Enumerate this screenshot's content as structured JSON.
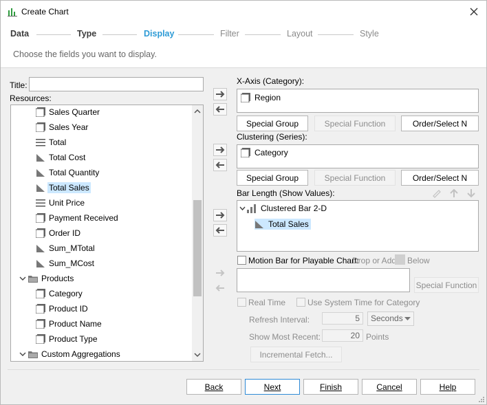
{
  "window": {
    "title": "Create Chart",
    "close_icon": "close-icon"
  },
  "steps": [
    {
      "label": "Data",
      "state": "done"
    },
    {
      "label": "Type",
      "state": "done"
    },
    {
      "label": "Display",
      "state": "active"
    },
    {
      "label": "Filter",
      "state": "todo"
    },
    {
      "label": "Layout",
      "state": "todo"
    },
    {
      "label": "Style",
      "state": "todo"
    }
  ],
  "subtitle": "Choose the fields you want to display.",
  "left": {
    "title_label": "Title:",
    "title_value": "",
    "resources_label": "Resources:",
    "tree": [
      {
        "label": "Sales Quarter",
        "icon": "dimension-icon"
      },
      {
        "label": "Sales Year",
        "icon": "dimension-icon"
      },
      {
        "label": "Total",
        "icon": "text-field-icon"
      },
      {
        "label": "Total Cost",
        "icon": "measure-icon"
      },
      {
        "label": "Total Quantity",
        "icon": "measure-icon"
      },
      {
        "label": "Total Sales",
        "icon": "measure-icon",
        "selected": true
      },
      {
        "label": "Unit Price",
        "icon": "text-field-icon"
      },
      {
        "label": "Payment Received",
        "icon": "dimension-icon"
      },
      {
        "label": "Order ID",
        "icon": "dimension-icon"
      },
      {
        "label": "Sum_MTotal",
        "icon": "measure-icon"
      },
      {
        "label": "Sum_MCost",
        "icon": "measure-icon"
      },
      {
        "label": "Products",
        "icon": "folder-icon",
        "folder": true
      },
      {
        "label": "Category",
        "icon": "dimension-icon"
      },
      {
        "label": "Product ID",
        "icon": "dimension-icon"
      },
      {
        "label": "Product Name",
        "icon": "dimension-icon"
      },
      {
        "label": "Product Type",
        "icon": "dimension-icon"
      },
      {
        "label": "Custom Aggregations",
        "icon": "folder-icon",
        "folder": true
      }
    ]
  },
  "xaxis": {
    "label": "X-Axis (Category):",
    "items": [
      "Region"
    ],
    "special_group": "Special Group",
    "special_function": "Special Function",
    "order_select": "Order/Select N"
  },
  "clustering": {
    "label": "Clustering (Series):",
    "items": [
      "Category"
    ],
    "special_group": "Special Group",
    "special_function": "Special Function",
    "order_select": "Order/Select N"
  },
  "bar_length": {
    "label": "Bar Length (Show Values):",
    "group": "Clustered Bar 2-D",
    "items": [
      "Total Sales"
    ]
  },
  "motion": {
    "label": "Motion Bar for Playable Chart:",
    "drop_hint": "Drop or Add",
    "below": "Below",
    "special_function": "Special Function"
  },
  "realtime": {
    "real_time": "Real Time",
    "use_system_time": "Use System Time for Category",
    "refresh_label": "Refresh Interval:",
    "refresh_value": "5",
    "refresh_unit": "Seconds",
    "recent_label": "Show Most Recent:",
    "recent_value": "20",
    "recent_unit": "Points",
    "incremental": "Incremental Fetch..."
  },
  "footer": {
    "back": "Back",
    "next": "Next",
    "finish": "Finish",
    "cancel": "Cancel",
    "help": "Help"
  }
}
